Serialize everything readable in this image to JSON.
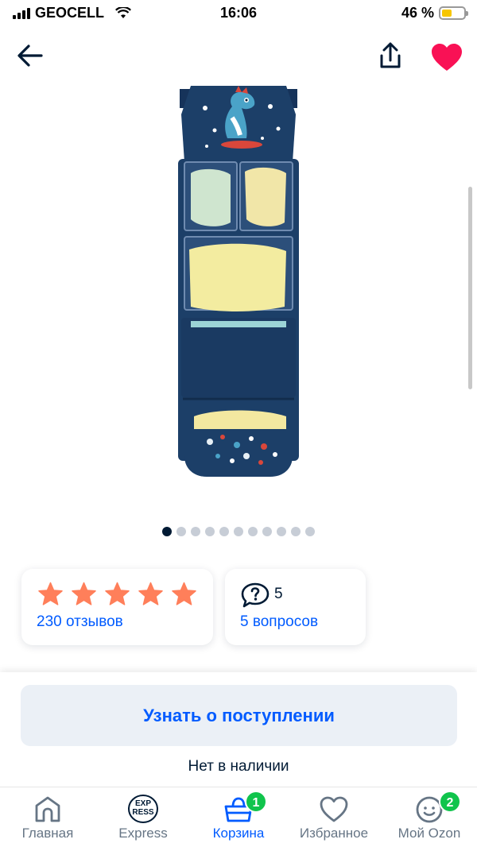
{
  "status_bar": {
    "carrier": "GEOCELL",
    "time": "16:06",
    "battery": "46 %",
    "battery_level": 0.46
  },
  "nav": {
    "back_icon": "arrow-left-icon",
    "share_icon": "share-icon",
    "favorite_icon": "heart-icon"
  },
  "gallery": {
    "image_count": 11,
    "active_index": 0
  },
  "rating": {
    "stars": 5,
    "reviews_label": "230 отзывов"
  },
  "questions": {
    "count": "5",
    "questions_label": "5 вопросов"
  },
  "actions": {
    "notify_label": "Узнать о поступлении",
    "availability": "Нет в наличии"
  },
  "tab_bar": [
    {
      "label": "Главная",
      "icon": "home-icon"
    },
    {
      "label": "Express",
      "icon": "express-icon",
      "logo_top": "EXP",
      "logo_bottom": "RESS"
    },
    {
      "label": "Корзина",
      "icon": "basket-icon",
      "badge": "1",
      "active": true
    },
    {
      "label": "Избранное",
      "icon": "heart-outline-icon"
    },
    {
      "label": "Мой Ozon",
      "icon": "profile-smile-icon",
      "badge": "2"
    }
  ],
  "colors": {
    "accent": "#005bff",
    "heart": "#f91155",
    "star": "#ff7f5a",
    "badge": "#10c44c",
    "text": "#001a34"
  }
}
